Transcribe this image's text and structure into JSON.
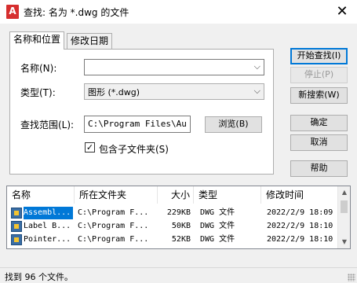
{
  "window": {
    "app_icon_letter": "A",
    "title": "查找: 名为 *.dwg 的文件",
    "close_glyph": "✕"
  },
  "tabs": [
    {
      "label": "名称和位置",
      "active": true
    },
    {
      "label": "修改日期",
      "active": false
    }
  ],
  "form": {
    "name_label": "名称(N):",
    "name_value": "",
    "type_label": "类型(T):",
    "type_value": "图形 (*.dwg)",
    "lookin_label": "查找范围(L):",
    "lookin_value": "C:\\Program Files\\Au",
    "browse_button": "浏览(B)",
    "include_subfolders_label": "包含子文件夹(S)",
    "include_subfolders_checked": true,
    "check_glyph": "✓",
    "dropdown_glyph": "⌵"
  },
  "actions": {
    "find_now": "开始查找(I)",
    "stop": "停止(P)",
    "new_search": "新搜索(W)",
    "ok": "确定",
    "cancel": "取消",
    "help": "帮助"
  },
  "results": {
    "columns": [
      "名称",
      "所在文件夹",
      "大小",
      "类型",
      "修改时间"
    ],
    "rows": [
      {
        "name": "Assembl...",
        "folder": "C:\\Program F...",
        "size": "229KB",
        "type": "DWG 文件",
        "modified": "2022/2/9 18:09",
        "selected": true
      },
      {
        "name": "Label B...",
        "folder": "C:\\Program F...",
        "size": "50KB",
        "type": "DWG 文件",
        "modified": "2022/2/9 18:10",
        "selected": false
      },
      {
        "name": "Pointer...",
        "folder": "C:\\Program F...",
        "size": "52KB",
        "type": "DWG 文件",
        "modified": "2022/2/9 18:10",
        "selected": false
      }
    ],
    "scroll_up_glyph": "▲",
    "scroll_down_glyph": "▼"
  },
  "status": {
    "text": "找到 96 个文件。"
  },
  "colors": {
    "selection": "#0078d7",
    "app_icon": "#d62e2e"
  }
}
